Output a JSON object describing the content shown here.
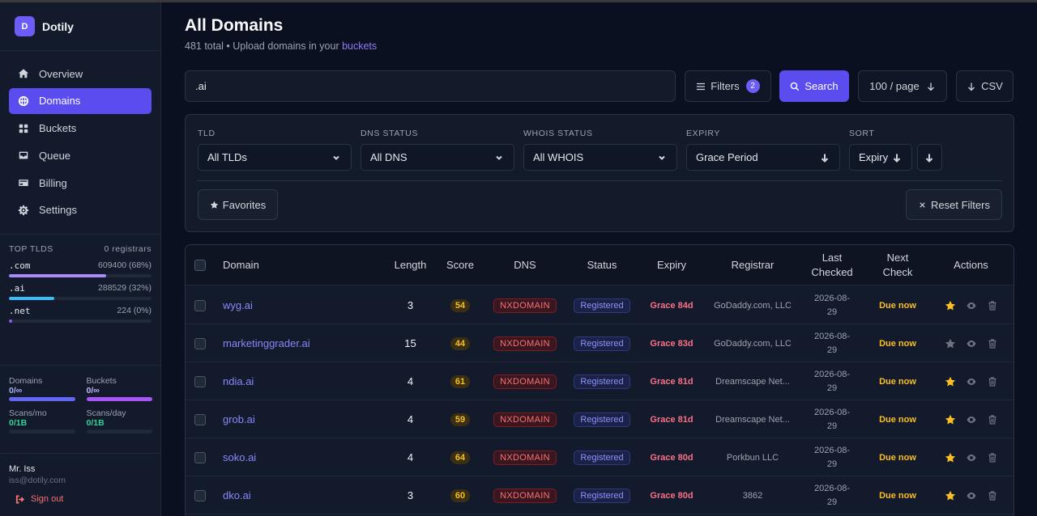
{
  "brand": {
    "initial": "D",
    "name": "Dotily"
  },
  "nav": [
    {
      "label": "Overview",
      "icon": "home-icon"
    },
    {
      "label": "Domains",
      "icon": "globe-icon",
      "active": true
    },
    {
      "label": "Buckets",
      "icon": "grid-icon"
    },
    {
      "label": "Queue",
      "icon": "inbox-icon"
    },
    {
      "label": "Billing",
      "icon": "card-icon"
    },
    {
      "label": "Settings",
      "icon": "gear-icon"
    }
  ],
  "top_tlds": {
    "title": "TOP TLDS",
    "registrars": "0 registrars",
    "items": [
      {
        "name": ".com",
        "stat": "609400 (68%)",
        "share": 0.68,
        "color": "#a78bfa"
      },
      {
        "name": ".ai",
        "stat": "288529 (32%)",
        "share": 0.32,
        "color": "#38bdf8"
      },
      {
        "name": ".net",
        "stat": "224 (0%)",
        "share": 0.02,
        "color": "#8b5cf6"
      }
    ]
  },
  "usage": [
    {
      "label": "Domains",
      "value": "0/∞",
      "color": "#6366f1",
      "value_color": "#a5b4fc"
    },
    {
      "label": "Buckets",
      "value": "0/∞",
      "color": "#a855f7",
      "value_color": "#c4b5fd"
    },
    {
      "label": "Scans/mo",
      "value": "0/1B",
      "color": "#1f2937",
      "value_color": "#34d399"
    },
    {
      "label": "Scans/day",
      "value": "0/1B",
      "color": "#1f2937",
      "value_color": "#34d399"
    }
  ],
  "user": {
    "name": "Mr. Iss",
    "email": "iss@dotily.com",
    "signout": "Sign out"
  },
  "header": {
    "title": "All Domains",
    "subtitle_prefix": "481 total • Upload domains in your ",
    "subtitle_link": "buckets"
  },
  "toolbar": {
    "search_value": ".ai",
    "filters_label": "Filters",
    "filters_count": "2",
    "search_label": "Search",
    "per_page_label": "100 / page",
    "csv_label": "CSV"
  },
  "filters": {
    "tld": {
      "label": "TLD",
      "value": "All TLDs"
    },
    "dns": {
      "label": "DNS STATUS",
      "value": "All DNS"
    },
    "whois": {
      "label": "WHOIS STATUS",
      "value": "All WHOIS"
    },
    "expiry": {
      "label": "EXPIRY",
      "value": "Grace Period"
    },
    "sort": {
      "label": "SORT",
      "value": "Expiry"
    },
    "favorites_label": "Favorites",
    "reset_label": "Reset Filters"
  },
  "table": {
    "columns": {
      "domain": "Domain",
      "length": "Length",
      "score": "Score",
      "dns": "DNS",
      "status": "Status",
      "expiry": "Expiry",
      "registrar": "Registrar",
      "last_checked_1": "Last",
      "last_checked_2": "Checked",
      "next_check_1": "Next",
      "next_check_2": "Check",
      "actions": "Actions"
    },
    "rows": [
      {
        "domain": "wyg.ai",
        "length": "3",
        "score": "54",
        "dns": "NXDOMAIN",
        "status": "Registered",
        "expiry": "Grace 84d",
        "registrar": "GoDaddy.com, LLC",
        "last_date": "2026-08-",
        "last_day": "29",
        "next": "Due now",
        "favorite": true
      },
      {
        "domain": "marketinggrader.ai",
        "length": "15",
        "score": "44",
        "dns": "NXDOMAIN",
        "status": "Registered",
        "expiry": "Grace 83d",
        "registrar": "GoDaddy.com, LLC",
        "last_date": "2026-08-",
        "last_day": "29",
        "next": "Due now",
        "favorite": false
      },
      {
        "domain": "ndia.ai",
        "length": "4",
        "score": "61",
        "dns": "NXDOMAIN",
        "status": "Registered",
        "expiry": "Grace 81d",
        "registrar": "Dreamscape Net...",
        "last_date": "2026-08-",
        "last_day": "29",
        "next": "Due now",
        "favorite": true
      },
      {
        "domain": "grob.ai",
        "length": "4",
        "score": "59",
        "dns": "NXDOMAIN",
        "status": "Registered",
        "expiry": "Grace 81d",
        "registrar": "Dreamscape Net...",
        "last_date": "2026-08-",
        "last_day": "29",
        "next": "Due now",
        "favorite": true
      },
      {
        "domain": "soko.ai",
        "length": "4",
        "score": "64",
        "dns": "NXDOMAIN",
        "status": "Registered",
        "expiry": "Grace 80d",
        "registrar": "Porkbun LLC",
        "last_date": "2026-08-",
        "last_day": "29",
        "next": "Due now",
        "favorite": true
      },
      {
        "domain": "dko.ai",
        "length": "3",
        "score": "60",
        "dns": "NXDOMAIN",
        "status": "Registered",
        "expiry": "Grace 80d",
        "registrar": "3862",
        "last_date": "2026-08-",
        "last_day": "29",
        "next": "Due now",
        "favorite": true
      }
    ]
  }
}
